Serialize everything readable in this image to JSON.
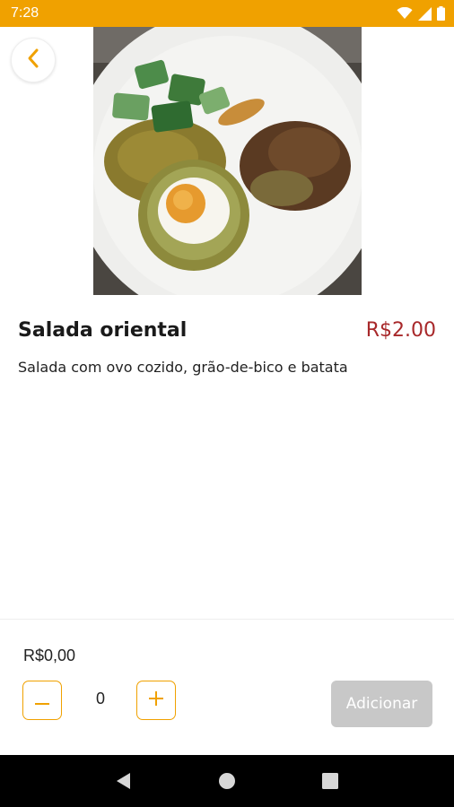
{
  "status_bar": {
    "time": "7:28",
    "icons": [
      "wifi-icon",
      "signal-icon",
      "battery-icon"
    ],
    "background_color": "#F0A100"
  },
  "header": {
    "back_icon": "chevron-left-icon",
    "accent_color": "#F0A100"
  },
  "product": {
    "name": "Salada oriental",
    "price": "R$2.00",
    "description": "Salada com ovo cozido, grão-de-bico e batata",
    "price_color": "#A8282A"
  },
  "order": {
    "total": "R$0,00",
    "quantity": "0",
    "decrement_icon": "minus-icon",
    "increment_icon": "plus-icon",
    "add_label": "Adicionar",
    "add_disabled_color": "#C8C8C8"
  },
  "nav_bar": {
    "icons": [
      "back-triangle-icon",
      "home-circle-icon",
      "recents-square-icon"
    ]
  }
}
